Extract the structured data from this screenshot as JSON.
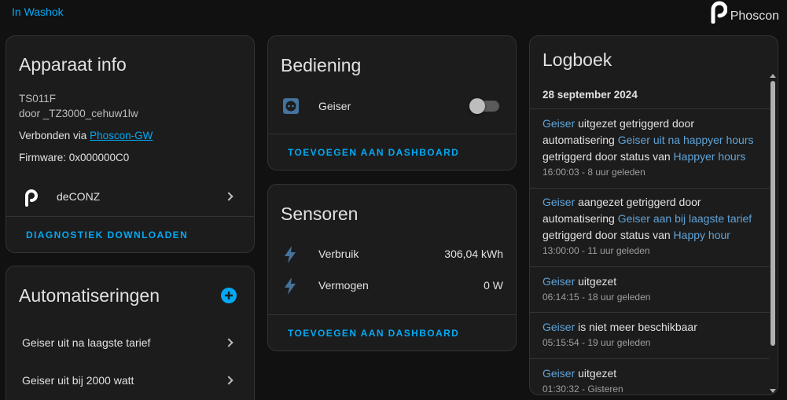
{
  "header": {
    "area_link": "In Washok",
    "brand": "Phoscon"
  },
  "device_info": {
    "title": "Apparaat info",
    "model": "TS011F",
    "manufacturer": "door _TZ3000_cehuw1lw",
    "connected_prefix": "Verbonden via ",
    "connected_link": "Phoscon-GW",
    "firmware": "Firmware: 0x000000C0",
    "integration": "deCONZ",
    "download_action": "DIAGNOSTIEK DOWNLOADEN"
  },
  "automations": {
    "title": "Automatiseringen",
    "items": [
      {
        "label": "Geiser uit na laagste tarief"
      },
      {
        "label": "Geiser uit bij 2000 watt"
      }
    ]
  },
  "controls": {
    "title": "Bediening",
    "entity": "Geiser",
    "toggle_state": "off",
    "action": "TOEVOEGEN AAN DASHBOARD"
  },
  "sensors": {
    "title": "Sensoren",
    "items": [
      {
        "label": "Verbruik",
        "value": "306,04 kWh"
      },
      {
        "label": "Vermogen",
        "value": "0 W"
      }
    ],
    "action": "TOEVOEGEN AAN DASHBOARD"
  },
  "logbook": {
    "title": "Logboek",
    "date": "28 september 2024",
    "entries": [
      {
        "entity": "Geiser",
        "t1": " uitgezet getriggerd door automatisering ",
        "link1": "Geiser uit na happyer hours",
        "t2": " getriggerd door status van ",
        "link2": "Happyer hours",
        "time": "16:00:03 - 8 uur geleden"
      },
      {
        "entity": "Geiser",
        "t1": " aangezet getriggerd door automatisering ",
        "link1": "Geiser aan bij laagste tarief",
        "t2": " getriggerd door status van ",
        "link2": "Happy hour",
        "time": "13:00:00 - 11 uur geleden"
      },
      {
        "entity": "Geiser",
        "t1": " uitgezet",
        "time": "06:14:15 - 18 uur geleden"
      },
      {
        "entity": "Geiser",
        "t1": " is niet meer beschikbaar",
        "time": "05:15:54 - 19 uur geleden"
      },
      {
        "entity": "Geiser",
        "t1": " uitgezet",
        "time": "01:30:32 - Gisteren"
      }
    ]
  },
  "colors": {
    "accent": "#03a9f4",
    "background": "#111111",
    "card": "#1c1c1c"
  }
}
